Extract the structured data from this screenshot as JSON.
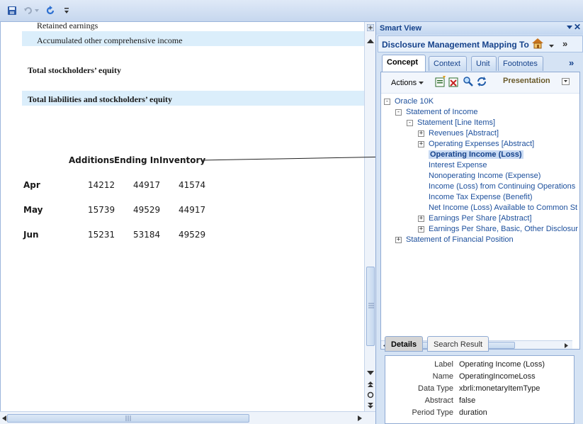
{
  "toolbar": {
    "save_icon": "save-icon",
    "undo_icon": "undo-icon",
    "redo_icon": "refresh-icon",
    "customize_icon": "customize-icon"
  },
  "document": {
    "lines": {
      "retained": "Retained earnings",
      "aoci": "Accumulated other comprehensive income",
      "total_equity": "Total stockholders’ equity",
      "total_liab": "Total liabilities and stockholders’ equity"
    },
    "table": {
      "headers": [
        "Additions",
        "Ending In",
        "Inventory"
      ],
      "rows": [
        {
          "label": "Apr",
          "values": [
            "14212",
            "44917",
            "41574"
          ]
        },
        {
          "label": "May",
          "values": [
            "15739",
            "49529",
            "44917"
          ]
        },
        {
          "label": "Jun",
          "values": [
            "15231",
            "53184",
            "49529"
          ]
        }
      ]
    }
  },
  "smart_view": {
    "title": "Smart View",
    "subtitle": "Disclosure Management Mapping Tool",
    "tabs": [
      "Concept",
      "Context",
      "Unit",
      "Footnotes"
    ],
    "active_tab": "Concept",
    "actions_label": "Actions",
    "presentation_label": "Presentation",
    "tree": [
      {
        "label": "Oracle 10K",
        "level": 0,
        "expander": "-"
      },
      {
        "label": "Statement of Income",
        "level": 1,
        "expander": "-"
      },
      {
        "label": "Statement [Line Items]",
        "level": 2,
        "expander": "-"
      },
      {
        "label": "Revenues [Abstract]",
        "level": 3,
        "expander": "+"
      },
      {
        "label": "Operating Expenses [Abstract]",
        "level": 3,
        "expander": "+"
      },
      {
        "label": "Operating Income (Loss)",
        "level": 3,
        "expander": "",
        "selected": true
      },
      {
        "label": "Interest Expense",
        "level": 3,
        "expander": ""
      },
      {
        "label": "Nonoperating Income (Expense)",
        "level": 3,
        "expander": ""
      },
      {
        "label": "Income (Loss) from Continuing Operations",
        "level": 3,
        "expander": ""
      },
      {
        "label": "Income Tax Expense (Benefit)",
        "level": 3,
        "expander": ""
      },
      {
        "label": "Net Income (Loss) Available to Common St",
        "level": 3,
        "expander": ""
      },
      {
        "label": "Earnings Per Share [Abstract]",
        "level": 3,
        "expander": "+"
      },
      {
        "label": "Earnings Per Share, Basic, Other Disclosur",
        "level": 3,
        "expander": "+"
      },
      {
        "label": "Statement of Financial Position",
        "level": 1,
        "expander": "+"
      }
    ],
    "detail_tabs": [
      "Details",
      "Search Result"
    ],
    "details": [
      {
        "label": "Label",
        "value": "Operating Income (Loss)"
      },
      {
        "label": "Name",
        "value": "OperatingIncomeLoss"
      },
      {
        "label": "Data Type",
        "value": "xbrli:monetaryItemType"
      },
      {
        "label": "Abstract",
        "value": "false"
      },
      {
        "label": "Period Type",
        "value": "duration"
      }
    ]
  }
}
